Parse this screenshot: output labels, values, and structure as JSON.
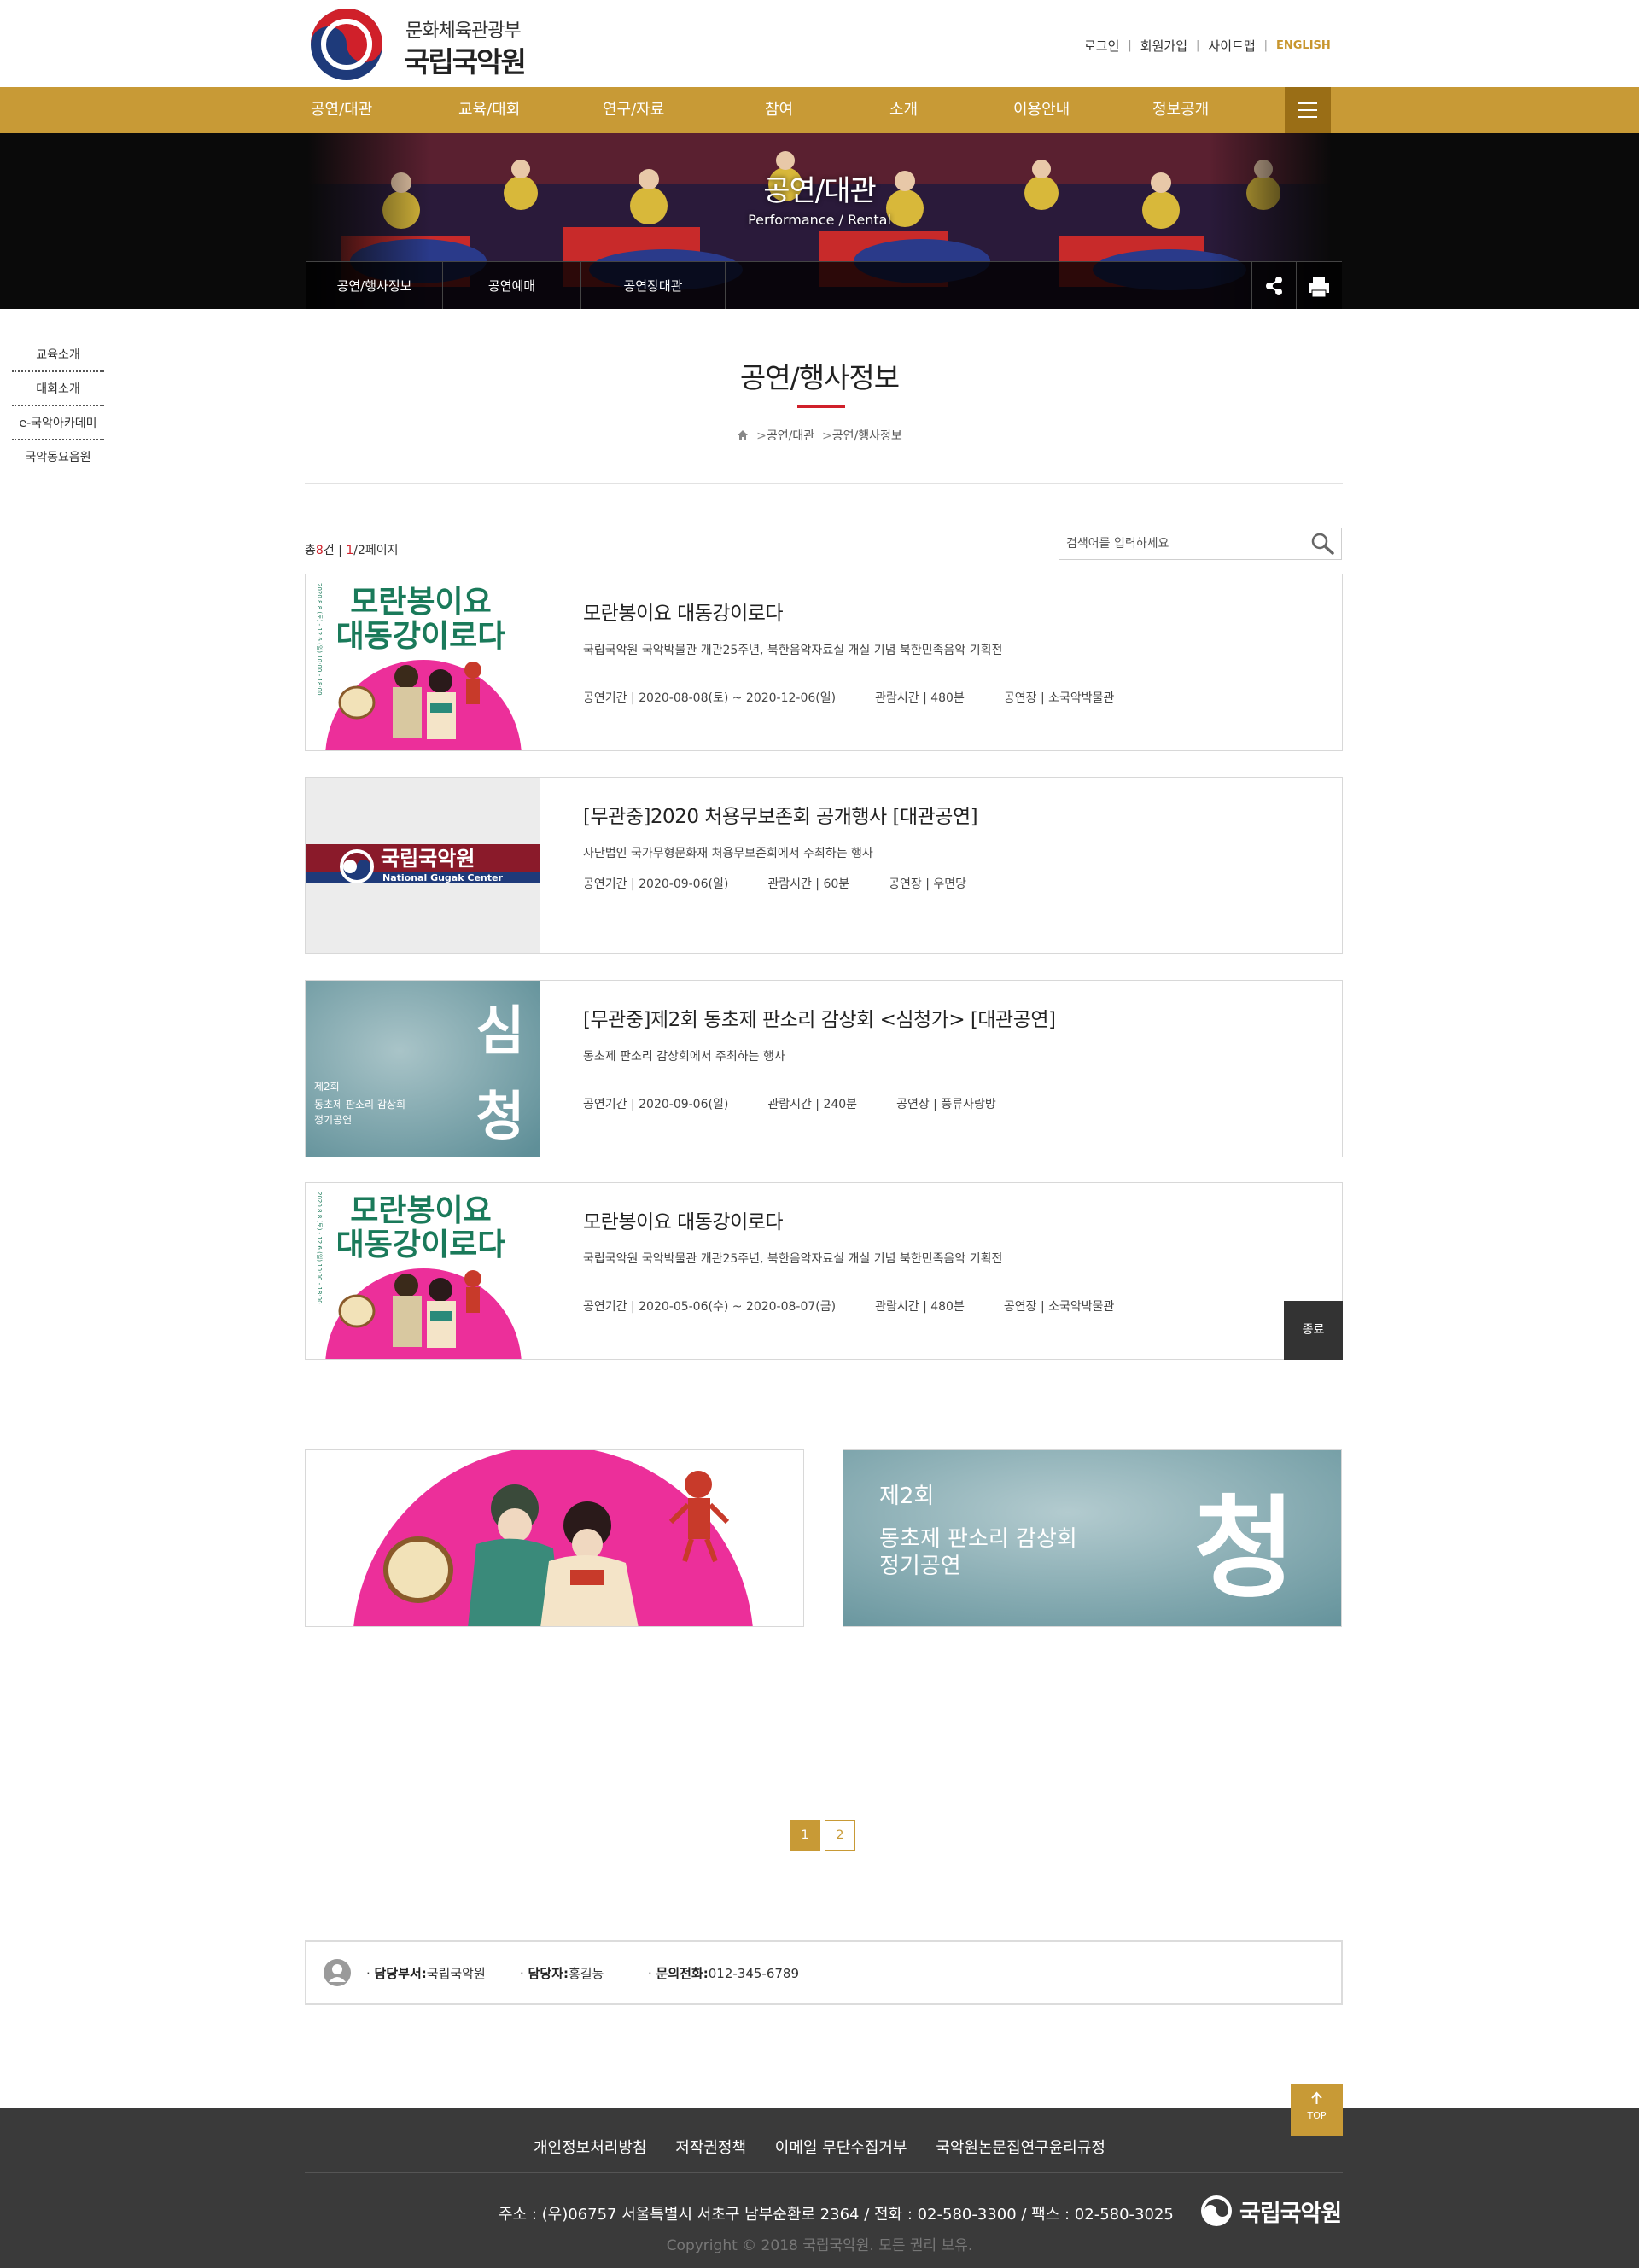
{
  "header": {
    "ministry": "문화체육관광부",
    "org": "국립국악원",
    "util": [
      "로그인",
      "회원가입",
      "사이트맵",
      "ENGLISH"
    ]
  },
  "gnb": [
    "공연/대관",
    "교육/대회",
    "연구/자료",
    "참여",
    "소개",
    "이용안내",
    "정보공개"
  ],
  "visual": {
    "title": "공연/대관",
    "subtitle": "Performance / Rental",
    "subnav": [
      "공연/행사정보",
      "공연예매",
      "공연장대관"
    ]
  },
  "side": [
    "교육소개",
    "대회소개",
    "e-국악아카데미",
    "국악동요음원"
  ],
  "page": {
    "title": "공연/행사정보",
    "breadcrumb": [
      "공연/대관",
      "공연/행사정보"
    ]
  },
  "list": {
    "total_prefix": "총",
    "total": "8",
    "total_suffix": "건",
    "page_current": "1",
    "page_total": "/2",
    "page_suffix": "페이지",
    "search_placeholder": "검색어를 입력하세요"
  },
  "events": [
    {
      "title": "모란봉이요 대동강이로다",
      "desc": "국립국악원 국악박물관 개관25주년, 북한음악자료실 개실 기념 북한민족음악 기획전",
      "period": "공연기간 | 2020-08-08(토) ~ 2020-12-06(일)",
      "runtime": "관람시간 | 480분",
      "venue": "공연장 | 소국악박물관",
      "badge": ""
    },
    {
      "title": "[무관중]2020 처용무보존회 공개행사 [대관공연]",
      "desc": "사단법인 국가무형문화재 처용무보존회에서 주최하는 행사",
      "period": "공연기간 | 2020-09-06(일)",
      "runtime": "관람시간 | 60분",
      "venue": "공연장 | 우면당",
      "badge": ""
    },
    {
      "title": "[무관중]제2회 동초제 판소리 감상회 <심청가> [대관공연]",
      "desc": "동초제 판소리 감상회에서 주최하는 행사",
      "period": "공연기간 | 2020-09-06(일)",
      "runtime": "관람시간 | 240분",
      "venue": "공연장 | 풍류사랑방",
      "badge": ""
    },
    {
      "title": "모란봉이요 대동강이로다",
      "desc": "국립국악원 국악박물관 개관25주년, 북한음악자료실 개실 기념 북한민족음악 기획전",
      "period": "공연기간 | 2020-05-06(수) ~ 2020-08-07(금)",
      "runtime": "관람시간 | 480분",
      "venue": "공연장 | 소국악박물관",
      "badge": "종료"
    }
  ],
  "thumbs": {
    "poster_title": [
      "모란봉이요",
      "대동강이로다"
    ],
    "poster_side": "2020.8.8.(토) - 12.6.(일)  10:00 - 18:00",
    "logo_ko": "국립국악원",
    "logo_en": "National Gugak Center",
    "simcheong": [
      "심",
      "청"
    ],
    "simcheong_lines": [
      "제2회",
      "동초제 판소리 감상회",
      "정기공연"
    ]
  },
  "banner_right": {
    "lines": [
      "제2회",
      "동초제 판소리 감상회",
      "정기공연"
    ],
    "big": "청"
  },
  "pager": [
    "1",
    "2"
  ],
  "contact": {
    "dept_label": "담당부서:",
    "dept": "국립국악원",
    "person_label": "담당자:",
    "person": "홍길동",
    "phone_label": "문의전화:",
    "phone": "012-345-6789"
  },
  "top_label": "TOP",
  "footer": {
    "links": [
      "개인정보처리방침",
      "저작권정책",
      "이메일 무단수집거부",
      "국악원논문집연구윤리규정"
    ],
    "address": "주소 : (우)06757 서울특별시 서초구 남부순환로 2364 / 전화 : 02-580-3300 / 팩스 : 02-580-3025",
    "copyright": "Copyright © 2018 국립국악원. 모든 권리 보유.",
    "logo": "국립국악원"
  },
  "colors": {
    "gold": "#c89a36",
    "red": "#d0202a",
    "dark": "#3a3a3a"
  }
}
